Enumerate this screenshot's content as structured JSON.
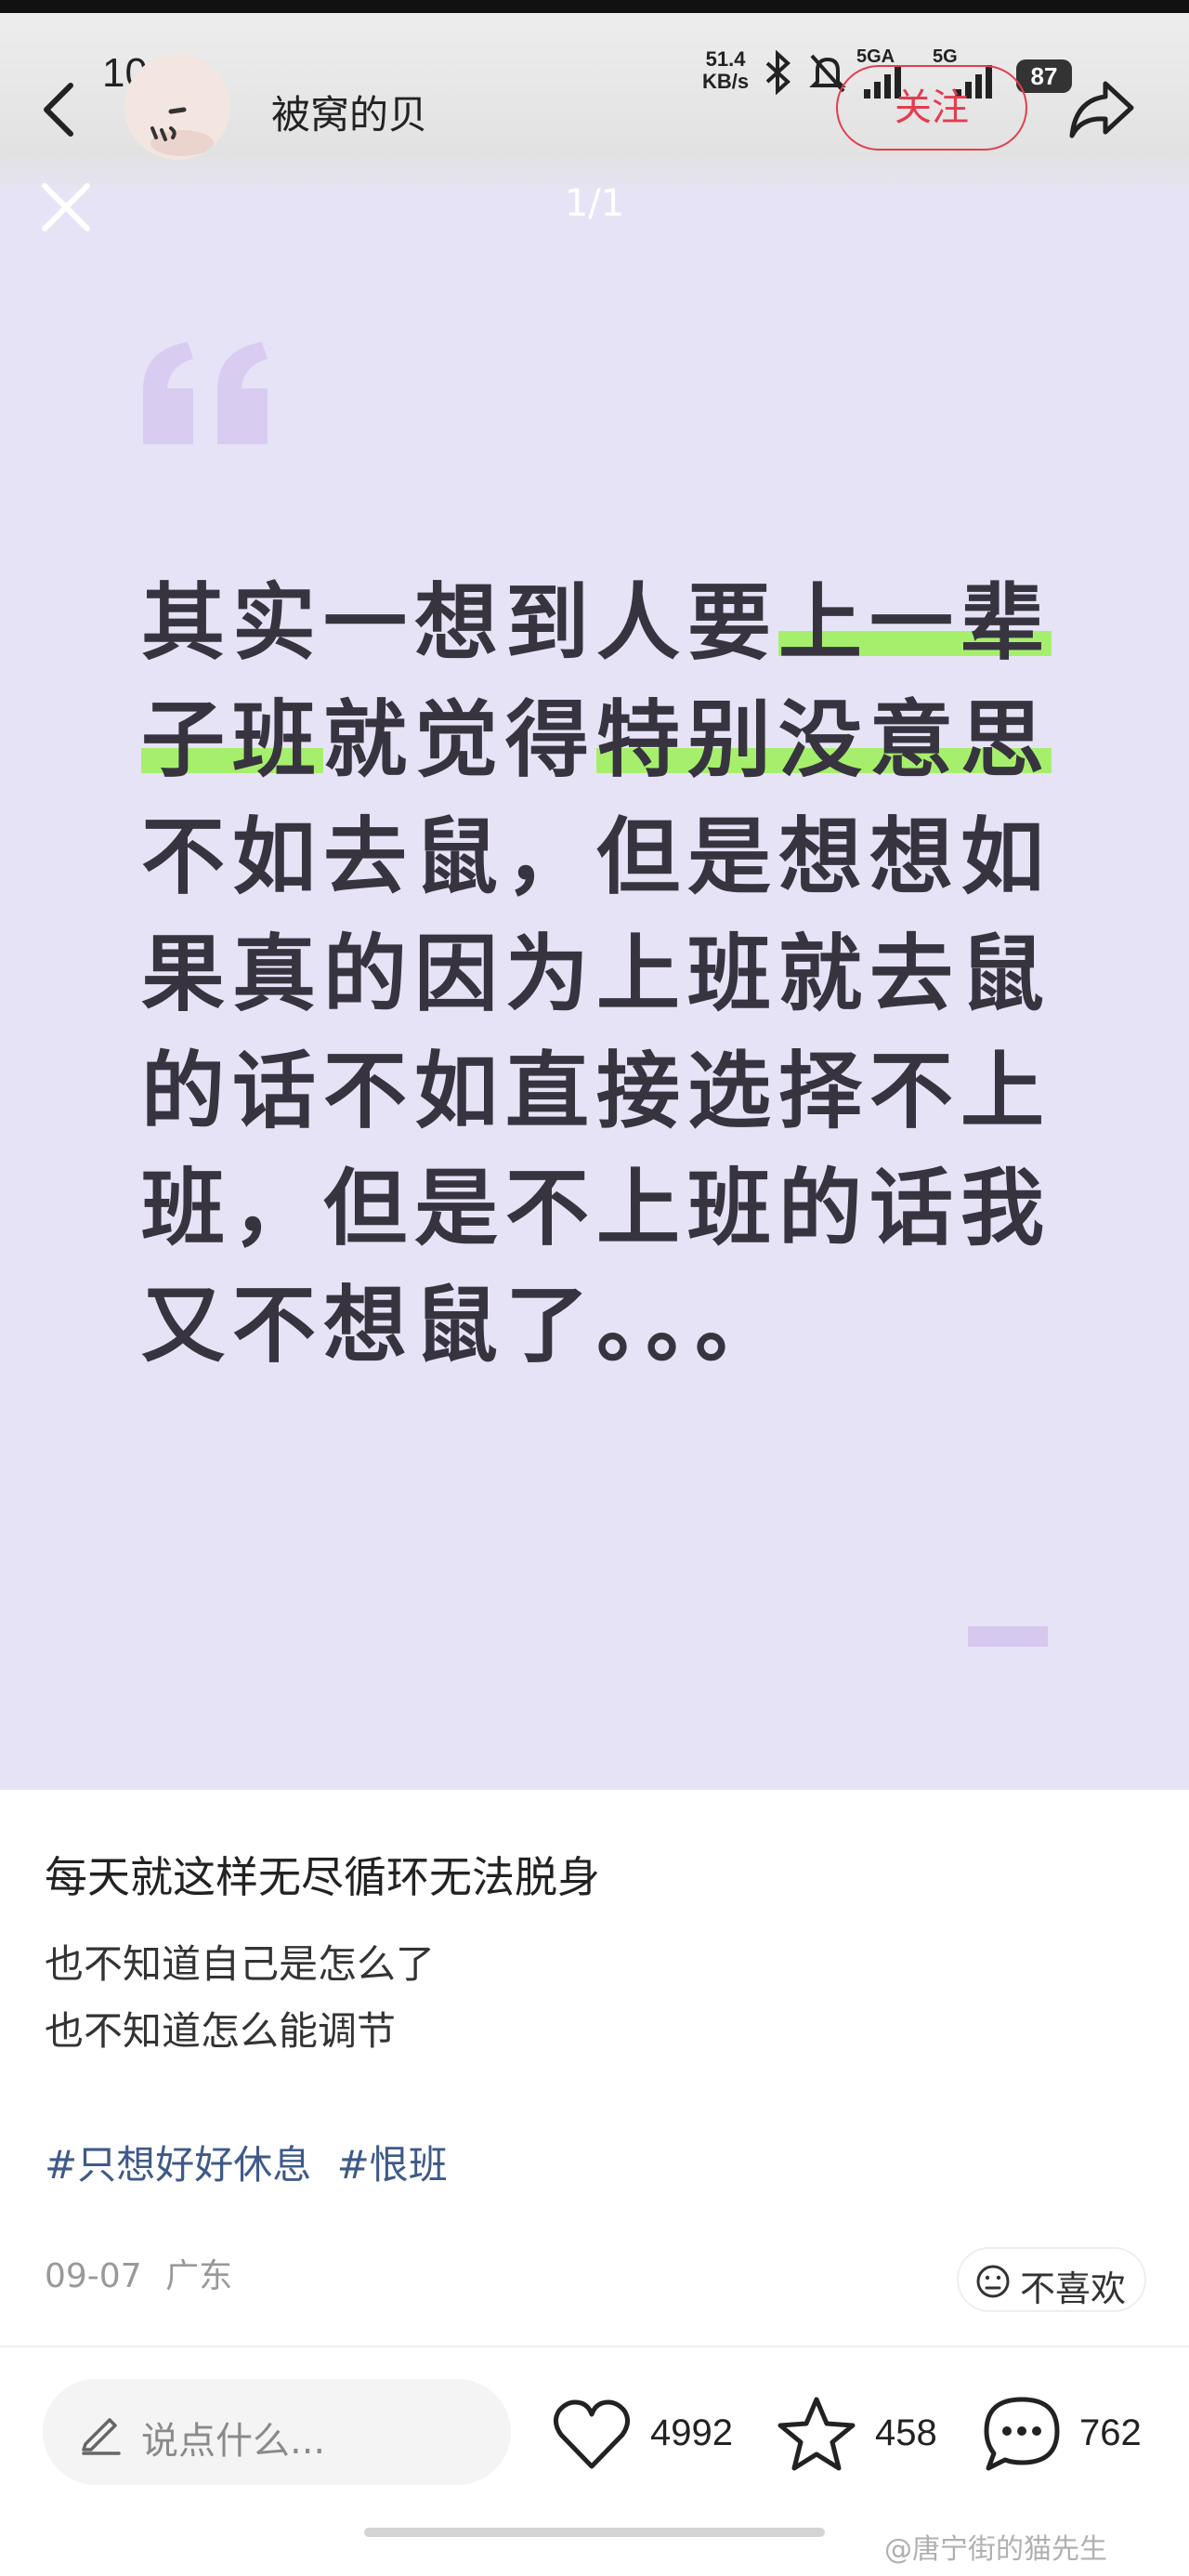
{
  "status_bar": {
    "time": "10:33",
    "net_speed_value": "51.4",
    "net_speed_unit": "KB/s",
    "signal_1": "5GA",
    "signal_2": "5G",
    "battery": "87"
  },
  "header": {
    "username": "被窝的贝",
    "follow_label": "关注",
    "icons": [
      "back-icon",
      "avatar",
      "share-icon"
    ]
  },
  "image_viewer": {
    "page_indicator": "1/1",
    "close_icon": "close-icon",
    "quote_segments": [
      {
        "text": "其实一想到人要",
        "highlight": false
      },
      {
        "text": "上一辈子班",
        "highlight": true
      },
      {
        "text": "就觉得",
        "highlight": false
      },
      {
        "text": "特别没意思",
        "highlight": true
      },
      {
        "text": "不如去鼠，但是想想如果真的因为上班就去鼠的话不如直接选择不上班，但是不上班的话我又不想鼠了。。。",
        "highlight": false
      }
    ],
    "colors": {
      "background": "#e7e3f7",
      "highlight": "#a6ef6c",
      "text": "#373440",
      "accent": "#d6c8ef"
    }
  },
  "post": {
    "title": "每天就这样无尽循环无法脱身",
    "lines": [
      "也不知道自己是怎么了",
      "也不知道怎么能调节"
    ],
    "tags": [
      "#只想好好休息",
      "#恨班"
    ],
    "date": "09-07",
    "location": "广东",
    "dislike_label": "不喜欢"
  },
  "bottom_bar": {
    "comment_placeholder": "说点什么...",
    "likes": "4992",
    "favorites": "458",
    "comments": "762"
  },
  "watermark": "@唐宁街的猫先生"
}
